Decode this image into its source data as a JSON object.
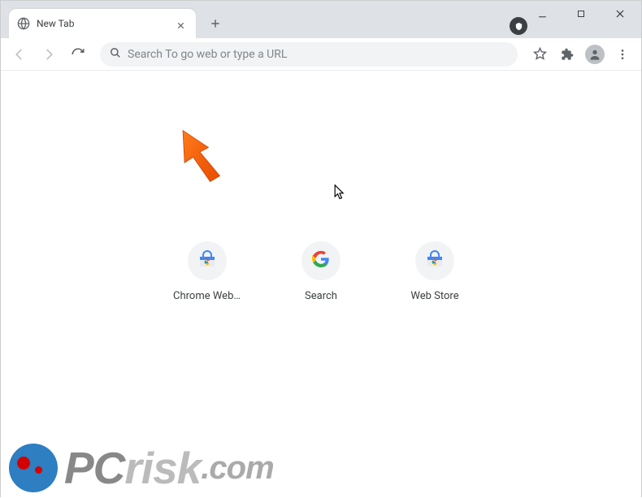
{
  "tab": {
    "title": "New Tab"
  },
  "omnibox": {
    "placeholder": "Search To go web or type a URL"
  },
  "shortcuts": [
    {
      "label": "Chrome Web …",
      "icon": "chrome-store"
    },
    {
      "label": "Search",
      "icon": "google"
    },
    {
      "label": "Web Store",
      "icon": "chrome-store"
    }
  ],
  "watermark": {
    "pc": "PC",
    "risk": "risk",
    "com": ".com"
  }
}
